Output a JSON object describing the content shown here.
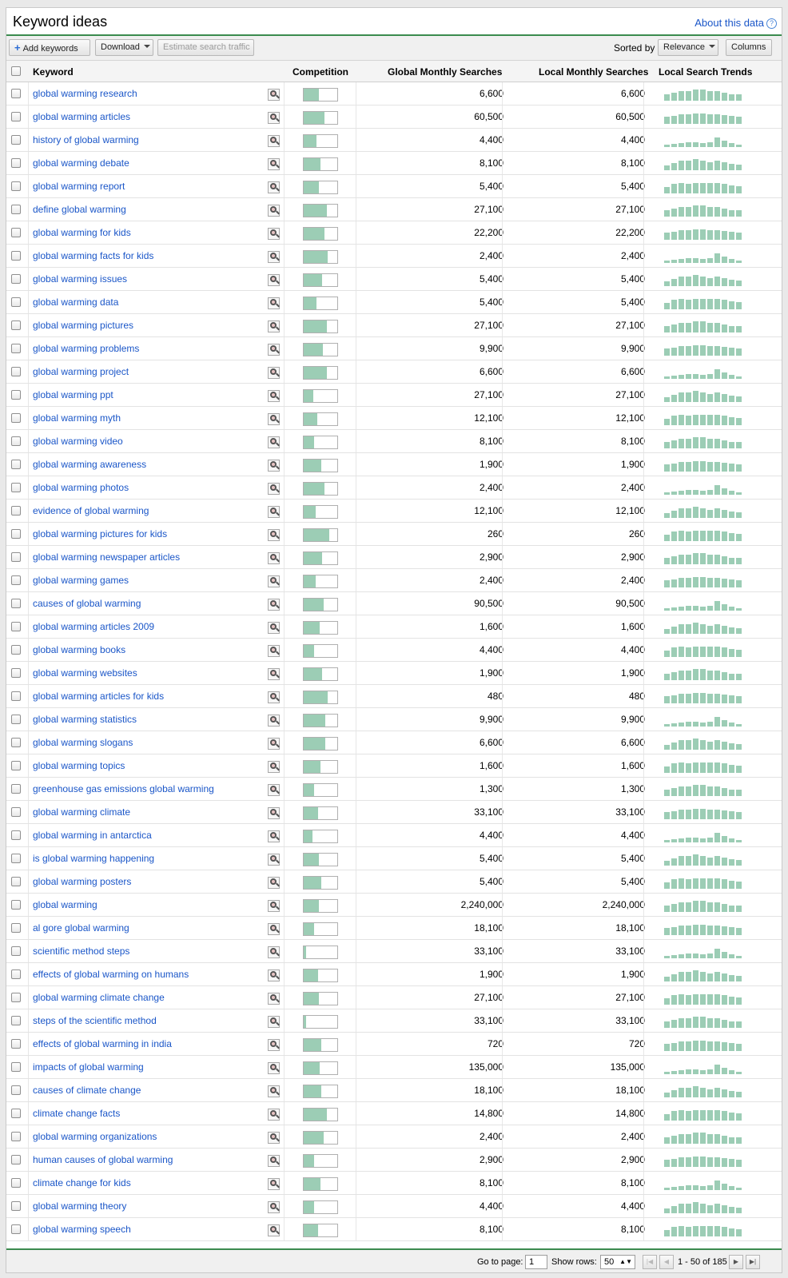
{
  "header": {
    "title": "Keyword ideas",
    "about_link": "About this data",
    "help_glyph": "?"
  },
  "toolbar": {
    "add_keywords": "Add keywords",
    "download": "Download",
    "estimate_traffic": "Estimate search traffic",
    "sorted_by_label": "Sorted by",
    "sort_value": "Relevance",
    "columns": "Columns"
  },
  "columns": {
    "keyword": "Keyword",
    "competition": "Competition",
    "global_monthly": "Global Monthly Searches",
    "local_monthly": "Local Monthly Searches",
    "trends": "Local Search Trends"
  },
  "rows": [
    {
      "keyword": "global warming research",
      "competition": 0.45,
      "global": "6,600",
      "local": "6,600"
    },
    {
      "keyword": "global warming articles",
      "competition": 0.62,
      "global": "60,500",
      "local": "60,500"
    },
    {
      "keyword": "history of global warming",
      "competition": 0.38,
      "global": "4,400",
      "local": "4,400"
    },
    {
      "keyword": "global warming debate",
      "competition": 0.5,
      "global": "8,100",
      "local": "8,100"
    },
    {
      "keyword": "global warming report",
      "competition": 0.45,
      "global": "5,400",
      "local": "5,400"
    },
    {
      "keyword": "define global warming",
      "competition": 0.68,
      "global": "27,100",
      "local": "27,100"
    },
    {
      "keyword": "global warming for kids",
      "competition": 0.62,
      "global": "22,200",
      "local": "22,200"
    },
    {
      "keyword": "global warming facts for kids",
      "competition": 0.72,
      "global": "2,400",
      "local": "2,400"
    },
    {
      "keyword": "global warming issues",
      "competition": 0.55,
      "global": "5,400",
      "local": "5,400"
    },
    {
      "keyword": "global warming data",
      "competition": 0.38,
      "global": "5,400",
      "local": "5,400"
    },
    {
      "keyword": "global warming pictures",
      "competition": 0.7,
      "global": "27,100",
      "local": "27,100"
    },
    {
      "keyword": "global warming problems",
      "competition": 0.58,
      "global": "9,900",
      "local": "9,900"
    },
    {
      "keyword": "global warming project",
      "competition": 0.68,
      "global": "6,600",
      "local": "6,600"
    },
    {
      "keyword": "global warming ppt",
      "competition": 0.28,
      "global": "27,100",
      "local": "27,100"
    },
    {
      "keyword": "global warming myth",
      "competition": 0.4,
      "global": "12,100",
      "local": "12,100"
    },
    {
      "keyword": "global warming video",
      "competition": 0.32,
      "global": "8,100",
      "local": "8,100"
    },
    {
      "keyword": "global warming awareness",
      "competition": 0.52,
      "global": "1,900",
      "local": "1,900"
    },
    {
      "keyword": "global warming photos",
      "competition": 0.62,
      "global": "2,400",
      "local": "2,400"
    },
    {
      "keyword": "evidence of global warming",
      "competition": 0.35,
      "global": "12,100",
      "local": "12,100"
    },
    {
      "keyword": "global warming pictures for kids",
      "competition": 0.75,
      "global": "260",
      "local": "260"
    },
    {
      "keyword": "global warming newspaper articles",
      "competition": 0.55,
      "global": "2,900",
      "local": "2,900"
    },
    {
      "keyword": "global warming games",
      "competition": 0.35,
      "global": "2,400",
      "local": "2,400"
    },
    {
      "keyword": "causes of global warming",
      "competition": 0.6,
      "global": "90,500",
      "local": "90,500"
    },
    {
      "keyword": "global warming articles 2009",
      "competition": 0.48,
      "global": "1,600",
      "local": "1,600"
    },
    {
      "keyword": "global warming books",
      "competition": 0.32,
      "global": "4,400",
      "local": "4,400"
    },
    {
      "keyword": "global warming websites",
      "competition": 0.55,
      "global": "1,900",
      "local": "1,900"
    },
    {
      "keyword": "global warming articles for kids",
      "competition": 0.72,
      "global": "480",
      "local": "480"
    },
    {
      "keyword": "global warming statistics",
      "competition": 0.65,
      "global": "9,900",
      "local": "9,900"
    },
    {
      "keyword": "global warming slogans",
      "competition": 0.65,
      "global": "6,600",
      "local": "6,600"
    },
    {
      "keyword": "global warming topics",
      "competition": 0.5,
      "global": "1,600",
      "local": "1,600"
    },
    {
      "keyword": "greenhouse gas emissions global warming",
      "competition": 0.32,
      "global": "1,300",
      "local": "1,300"
    },
    {
      "keyword": "global warming climate",
      "competition": 0.42,
      "global": "33,100",
      "local": "33,100"
    },
    {
      "keyword": "global warming in antarctica",
      "competition": 0.25,
      "global": "4,400",
      "local": "4,400"
    },
    {
      "keyword": "is global warming happening",
      "competition": 0.45,
      "global": "5,400",
      "local": "5,400"
    },
    {
      "keyword": "global warming posters",
      "competition": 0.52,
      "global": "5,400",
      "local": "5,400"
    },
    {
      "keyword": "global warming",
      "competition": 0.45,
      "global": "2,240,000",
      "local": "2,240,000"
    },
    {
      "keyword": "al gore global warming",
      "competition": 0.3,
      "global": "18,100",
      "local": "18,100"
    },
    {
      "keyword": "scientific method steps",
      "competition": 0.08,
      "global": "33,100",
      "local": "33,100"
    },
    {
      "keyword": "effects of global warming on humans",
      "competition": 0.42,
      "global": "1,900",
      "local": "1,900"
    },
    {
      "keyword": "global warming climate change",
      "competition": 0.45,
      "global": "27,100",
      "local": "27,100"
    },
    {
      "keyword": "steps of the scientific method",
      "competition": 0.08,
      "global": "33,100",
      "local": "33,100"
    },
    {
      "keyword": "effects of global warming in india",
      "competition": 0.52,
      "global": "720",
      "local": "720"
    },
    {
      "keyword": "impacts of global warming",
      "competition": 0.48,
      "global": "135,000",
      "local": "135,000"
    },
    {
      "keyword": "causes of climate change",
      "competition": 0.52,
      "global": "18,100",
      "local": "18,100"
    },
    {
      "keyword": "climate change facts",
      "competition": 0.7,
      "global": "14,800",
      "local": "14,800"
    },
    {
      "keyword": "global warming organizations",
      "competition": 0.6,
      "global": "2,400",
      "local": "2,400"
    },
    {
      "keyword": "human causes of global warming",
      "competition": 0.32,
      "global": "2,900",
      "local": "2,900"
    },
    {
      "keyword": "climate change for kids",
      "competition": 0.5,
      "global": "8,100",
      "local": "8,100"
    },
    {
      "keyword": "global warming theory",
      "competition": 0.3,
      "global": "4,400",
      "local": "4,400"
    },
    {
      "keyword": "global warming speech",
      "competition": 0.42,
      "global": "8,100",
      "local": "8,100"
    }
  ],
  "footer": {
    "goto_label": "Go to page:",
    "goto_value": "1",
    "show_rows_label": "Show rows:",
    "show_rows_value": "50",
    "range_text": "1 - 50 of 185"
  },
  "colors": {
    "accent_green": "#3b8b4e",
    "bar_green": "#9ccdb5",
    "link_blue": "#1a56c8"
  }
}
